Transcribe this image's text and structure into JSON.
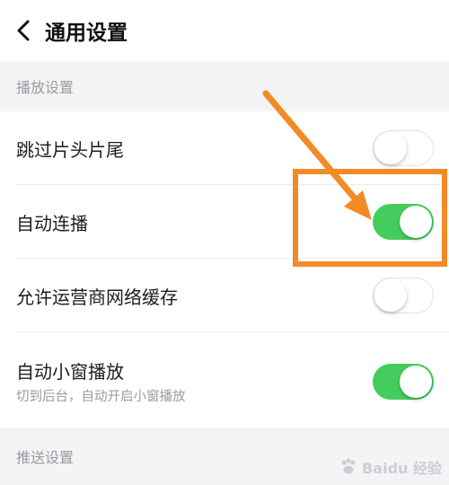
{
  "header": {
    "title": "通用设置",
    "back_icon": "chevron-left-icon"
  },
  "sections": {
    "playback": {
      "title": "播放设置",
      "items": [
        {
          "label": "跳过片头片尾",
          "toggle_on": false
        },
        {
          "label": "自动连播",
          "toggle_on": true
        },
        {
          "label": "允许运营商网络缓存",
          "toggle_on": false
        },
        {
          "label": "自动小窗播放",
          "sublabel": "切到后台，自动开启小窗播放",
          "toggle_on": true
        }
      ]
    },
    "push": {
      "title": "推送设置"
    }
  },
  "annotation": {
    "color": "#f28a25",
    "icons": [
      "arrow-icon",
      "highlight-box"
    ]
  },
  "watermark": {
    "text": "Baidu 经验"
  },
  "colors": {
    "toggle_on": "#43cd5c",
    "toggle_off_border": "#e3e3e6",
    "section_text": "#9a9a9f"
  }
}
